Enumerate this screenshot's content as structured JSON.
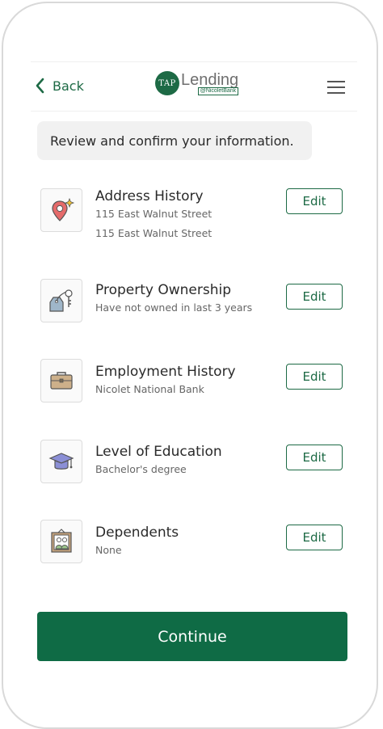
{
  "header": {
    "back_label": "Back",
    "logo": {
      "tap_text": "TAP",
      "lending_text": "Lending",
      "sub_text": "@NicoletBank"
    },
    "menu_icon": "hamburger-menu-icon"
  },
  "intro": {
    "message": "Review and confirm your information."
  },
  "items": [
    {
      "icon": "location-pin-icon",
      "title": "Address History",
      "lines": [
        "115 East Walnut Street",
        "115 East Walnut Street"
      ],
      "edit_label": "Edit"
    },
    {
      "icon": "keys-tag-icon",
      "title": "Property Ownership",
      "lines": [
        "Have not owned in last 3 years"
      ],
      "edit_label": "Edit"
    },
    {
      "icon": "briefcase-icon",
      "title": "Employment History",
      "lines": [
        "Nicolet National Bank"
      ],
      "edit_label": "Edit"
    },
    {
      "icon": "graduation-cap-icon",
      "title": "Level of Education",
      "lines": [
        "Bachelor's degree"
      ],
      "edit_label": "Edit"
    },
    {
      "icon": "family-portrait-icon",
      "title": "Dependents",
      "lines": [
        "None"
      ],
      "edit_label": "Edit"
    }
  ],
  "footer": {
    "continue_label": "Continue"
  },
  "colors": {
    "brand_green": "#1d6a45",
    "button_green": "#0f6b45"
  }
}
